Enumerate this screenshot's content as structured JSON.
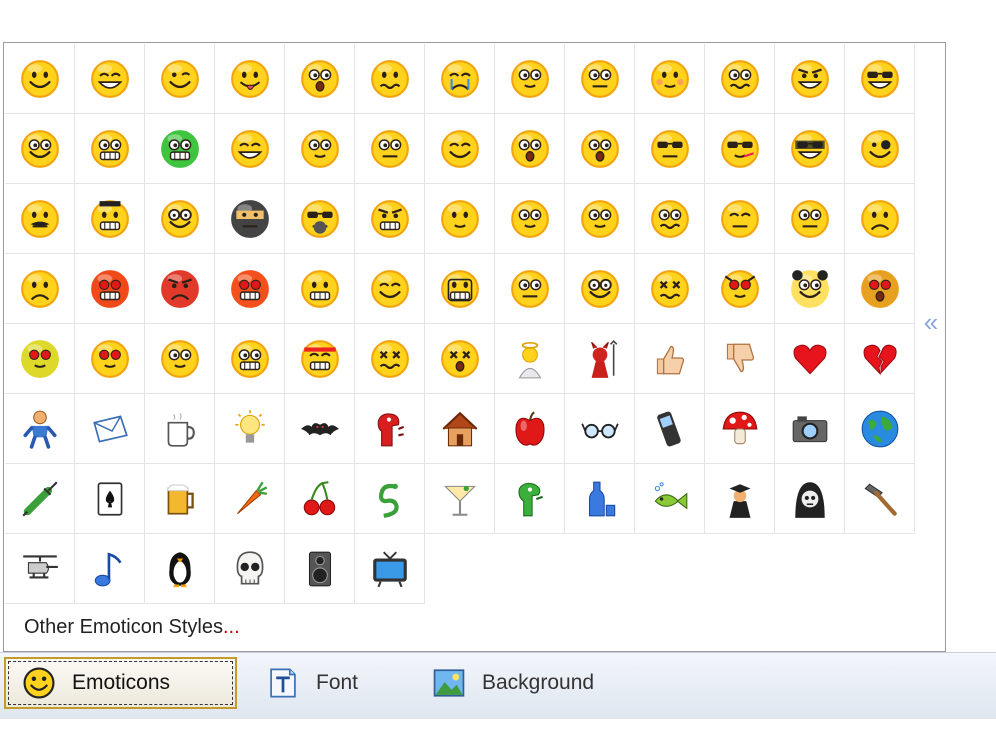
{
  "emoticons": [
    "smile",
    "grin",
    "wink",
    "tongue",
    "surprised",
    "confused",
    "crying",
    "embarrassed",
    "straight-face",
    "blush",
    "worried",
    "angry",
    "cool",
    "rolling-eyes",
    "teeth",
    "sick",
    "happy",
    "nerd",
    "thinking",
    "laughing",
    "shocked",
    "shocked-open",
    "sunglasses",
    "smoking",
    "bandit",
    "pirate",
    "moustache",
    "mr-t",
    "geek",
    "ninja",
    "gas-mask",
    "devil-face",
    "innocent",
    "eyes-wide",
    "looking-up",
    "crossed-eyes",
    "sleepy",
    "puzzled",
    "sad",
    "frown",
    "evil-grin",
    "mad",
    "furious",
    "big-grin",
    "smirk",
    "robot",
    "peeking",
    "glasses",
    "dead",
    "cat",
    "panda",
    "scared",
    "alien",
    "red-eyes",
    "cyclops",
    "cyborg",
    "headband",
    "dizzy",
    "knocked-out",
    "angel",
    "devil",
    "thumbs-up",
    "thumbs-down",
    "heart",
    "broken-heart",
    "person",
    "envelope",
    "coffee-cup",
    "light-bulb",
    "bat",
    "dinosaur-red",
    "house",
    "apple",
    "eyeglasses",
    "mobile-phone",
    "mushroom",
    "camera",
    "globe",
    "syringe",
    "playing-card",
    "beer-mug",
    "carrot",
    "cherries",
    "snake",
    "cocktail",
    "dinosaur-green",
    "bottle",
    "fish",
    "graduate",
    "grim-reaper",
    "hammer",
    "helicopter",
    "music-note",
    "penguin",
    "skull",
    "speaker",
    "television"
  ],
  "collapse_glyph": "«",
  "other_styles": {
    "label": "Other Emoticon Styles",
    "dots": "..."
  },
  "tabs": {
    "emoticons": "Emoticons",
    "font": "Font",
    "background": "Background"
  }
}
